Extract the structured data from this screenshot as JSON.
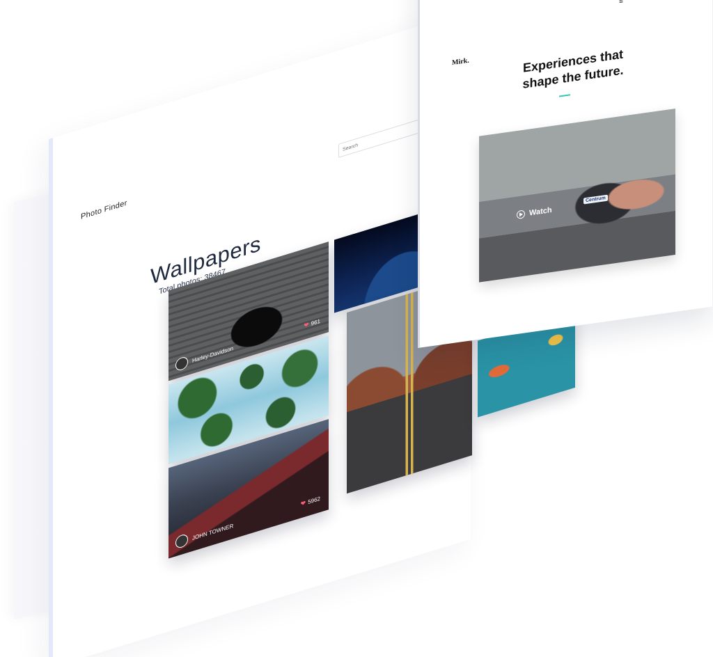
{
  "photo_finder": {
    "brand": "Photo Finder",
    "search": {
      "placeholder": "Search"
    },
    "heading": "Wallpapers",
    "total_label": "Total photos: 38467",
    "tiles": [
      {
        "id": "harley",
        "author": "Harley-Davidson",
        "likes": "961"
      },
      {
        "id": "palms"
      },
      {
        "id": "mountains",
        "author": "JOHN TOWNER",
        "likes": "5962"
      },
      {
        "id": "night-road"
      },
      {
        "id": "desert-road"
      },
      {
        "id": "electric-motorcycle"
      },
      {
        "id": "balloons"
      }
    ]
  },
  "mirk": {
    "brand": "Mirk.",
    "menu_icon": "hamburger-icon",
    "headline": "Experiences that shape the future.",
    "hero": {
      "cta_label": "Watch",
      "phone_text": "Centrum"
    },
    "accent_color": "#35c7b0"
  }
}
